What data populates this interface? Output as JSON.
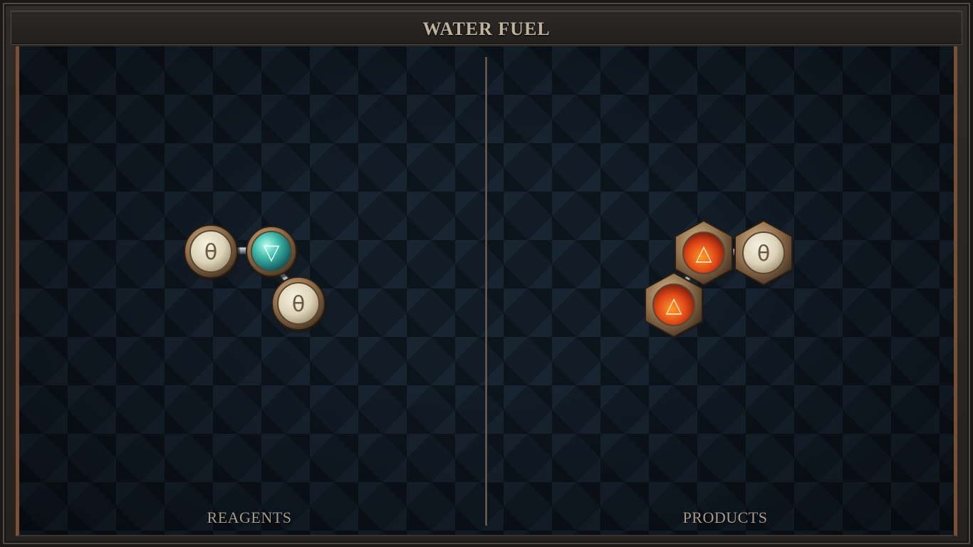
{
  "title": "WATER FUEL",
  "reagents": {
    "label": "REAGENTS",
    "atoms": [
      {
        "element": "salt",
        "symbol": "θ"
      },
      {
        "element": "water",
        "symbol": "▽"
      },
      {
        "element": "salt",
        "symbol": "θ"
      }
    ]
  },
  "products": {
    "label": "PRODUCTS",
    "atoms": [
      {
        "element": "fire",
        "symbol": "△"
      },
      {
        "element": "salt",
        "symbol": "θ"
      },
      {
        "element": "fire",
        "symbol": "△"
      }
    ]
  },
  "colors": {
    "salt": "#e8e0c8",
    "water": "#3fb8a8",
    "fire": "#e04818",
    "bronze": "#8a6a48"
  }
}
